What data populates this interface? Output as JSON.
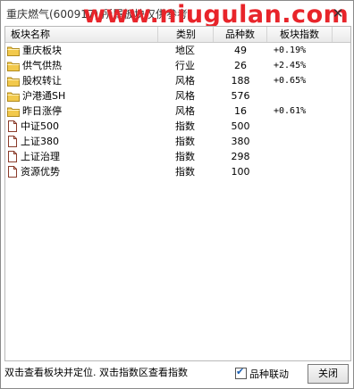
{
  "window": {
    "title": "重庆燃气(600917) 所属板块仅供参考",
    "watermark": "www.niugulan.com",
    "close_glyph": "✕"
  },
  "table": {
    "columns": [
      "板块名称",
      "类别",
      "品种数",
      "板块指数"
    ],
    "rows": [
      {
        "icon": "folder-icon",
        "name": "重庆板块",
        "type": "地区",
        "count": "49",
        "index": "+0.19%"
      },
      {
        "icon": "folder-icon",
        "name": "供气供热",
        "type": "行业",
        "count": "26",
        "index": "+2.45%"
      },
      {
        "icon": "folder-icon",
        "name": "股权转让",
        "type": "风格",
        "count": "188",
        "index": "+0.65%"
      },
      {
        "icon": "folder-icon",
        "name": "沪港通SH",
        "type": "风格",
        "count": "576",
        "index": ""
      },
      {
        "icon": "folder-icon",
        "name": "昨日涨停",
        "type": "风格",
        "count": "16",
        "index": "+0.61%"
      },
      {
        "icon": "document-icon",
        "name": "中证500",
        "type": "指数",
        "count": "500",
        "index": ""
      },
      {
        "icon": "document-icon",
        "name": "上证380",
        "type": "指数",
        "count": "380",
        "index": ""
      },
      {
        "icon": "document-icon",
        "name": "上证治理",
        "type": "指数",
        "count": "298",
        "index": ""
      },
      {
        "icon": "document-icon",
        "name": "资源优势",
        "type": "指数",
        "count": "100",
        "index": ""
      }
    ]
  },
  "footer": {
    "hint": "双击查看板块并定位. 双击指数区查看指数",
    "checkbox_label": "品种联动",
    "checkbox_checked": true,
    "close_button": "关闭"
  },
  "colors": {
    "watermark": "#e8242a",
    "folder": "#f2c94c",
    "check": "#1a5fb4"
  }
}
